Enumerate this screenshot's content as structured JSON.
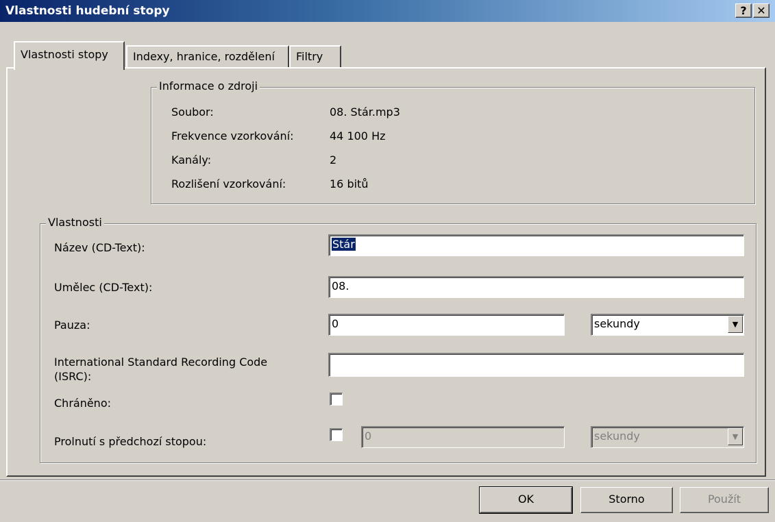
{
  "window": {
    "title": "Vlastnosti hudební stopy",
    "help_label": "?",
    "close_label": "✕"
  },
  "tabs": [
    {
      "label": "Vlastnosti stopy",
      "active": true
    },
    {
      "label": "Indexy, hranice, rozdělení",
      "active": false
    },
    {
      "label": "Filtry",
      "active": false
    }
  ],
  "source_info": {
    "group_label": "Informace o zdroji",
    "rows": [
      {
        "label": "Soubor:",
        "value": "08. Stár.mp3"
      },
      {
        "label": "Frekvence vzorkování:",
        "value": "44 100 Hz"
      },
      {
        "label": "Kanály:",
        "value": "2"
      },
      {
        "label": "Rozlišení vzorkování:",
        "value": "16 bitů"
      }
    ]
  },
  "properties": {
    "group_label": "Vlastnosti",
    "title_label": "Název (CD-Text):",
    "title_value": "Stár",
    "artist_label": "Umělec (CD-Text):",
    "artist_value": "08.",
    "pause_label": "Pauza:",
    "pause_value": "0",
    "pause_unit": "sekundy",
    "isrc_label_line1": "International Standard Recording Code",
    "isrc_label_line2": "(ISRC):",
    "isrc_value": "",
    "protected_label": "Chráněno:",
    "protected_checked": false,
    "crossfade_label": "Prolnutí s předchozí stopou:",
    "crossfade_checked": false,
    "crossfade_value": "0",
    "crossfade_unit": "sekundy"
  },
  "buttons": {
    "ok": "OK",
    "cancel": "Storno",
    "apply": "Použít"
  },
  "icons": {
    "dropdown": "▼"
  }
}
